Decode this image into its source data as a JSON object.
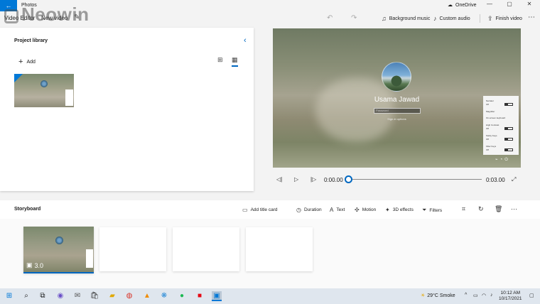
{
  "titlebar": {
    "app_title": "Photos",
    "onedrive": "OneDrive"
  },
  "commandbar": {
    "crumb_video_editor": "Video Editor",
    "crumb_new_video": "New video",
    "background_music": "Background music",
    "custom_audio": "Custom audio",
    "finish_video": "Finish video"
  },
  "watermark": {
    "text": "Neowin"
  },
  "library": {
    "title": "Project library",
    "add_label": "Add"
  },
  "preview": {
    "username": "Usama Jawad",
    "password_placeholder": "Password",
    "signin_options": "Sign-in options",
    "accessibility": [
      {
        "label": "Narrator",
        "state": "Off"
      },
      {
        "label": "Magnifier",
        "state": ""
      },
      {
        "label": "On-screen keyboard",
        "state": ""
      },
      {
        "label": "High Contrast",
        "state": "Off"
      },
      {
        "label": "Sticky Keys",
        "state": "Off"
      },
      {
        "label": "Filter Keys",
        "state": "Off"
      }
    ]
  },
  "playback": {
    "current_time": "0:00.00",
    "end_time": "0:03.00",
    "progress": 0
  },
  "storyboard": {
    "title": "Storyboard",
    "add_title_card": "Add title card",
    "duration": "Duration",
    "text": "Text",
    "motion": "Motion",
    "effects_3d": "3D effects",
    "filters": "Filters",
    "clip_duration": "3.0"
  },
  "taskbar": {
    "weather": "29°C  Smoke",
    "time": "10:12 AM",
    "date": "10/17/2021"
  },
  "colors": {
    "accent": "#0067c0",
    "titlebar_back": "#0078d7"
  }
}
